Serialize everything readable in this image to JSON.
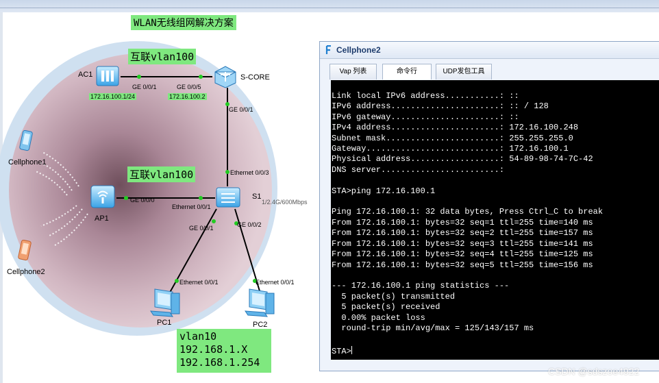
{
  "diagram": {
    "title": "WLAN无线组网解决方案",
    "interconnect_label_top": "互联vlan100",
    "interconnect_label_mid": "互联vlan100",
    "devices": {
      "ac1": "AC1",
      "score": "S-CORE",
      "s1": "S1",
      "ap1": "AP1",
      "pc1": "PC1",
      "pc2": "PC2",
      "cellphone1": "Cellphone1",
      "cellphone2": "Cellphone2"
    },
    "ip_labels": {
      "ac1_ip": "172.16.100.1/24",
      "score_ip": "172.16.100.2"
    },
    "ports": {
      "ac1_ge001": "GE 0/0/1",
      "score_ge005": "GE 0/0/5",
      "score_ge001": "GE 0/0/1",
      "s1_eth003": "Ethernet 0/0/3",
      "ap1_ge000": "GE 0/0/0",
      "s1_eth001": "Ethernet 0/0/1",
      "s1_ge001": "GE 0/0/1",
      "s1_ge002": "GE 0/0/2",
      "pc1_eth001": "Ethernet 0/0/1",
      "pc2_eth001": "Ethernet 0/0/1"
    },
    "speed": "1/2.4G/600Mbps",
    "vlan_box": [
      "vlan10",
      "192.168.1.X",
      "192.168.1.254"
    ]
  },
  "window": {
    "title": "Cellphone2",
    "tabs": [
      "Vap 列表",
      "命令行",
      "UDP发包工具"
    ],
    "console_lines": [
      "Link local IPv6 address...........: ::",
      "IPv6 address......................: :: / 128",
      "IPv6 gateway......................: ::",
      "IPv4 address......................: 172.16.100.248",
      "Subnet mask.......................: 255.255.255.0",
      "Gateway...........................: 172.16.100.1",
      "Physical address..................: 54-89-98-74-7C-42",
      "DNS server........................:",
      "",
      "STA>ping 172.16.100.1",
      "",
      "Ping 172.16.100.1: 32 data bytes, Press Ctrl_C to break",
      "From 172.16.100.1: bytes=32 seq=1 ttl=255 time=140 ms",
      "From 172.16.100.1: bytes=32 seq=2 ttl=255 time=157 ms",
      "From 172.16.100.1: bytes=32 seq=3 ttl=255 time=141 ms",
      "From 172.16.100.1: bytes=32 seq=4 ttl=255 time=125 ms",
      "From 172.16.100.1: bytes=32 seq=5 ttl=255 time=156 ms",
      "",
      "--- 172.16.100.1 ping statistics ---",
      "  5 packet(s) transmitted",
      "  5 packet(s) received",
      "  0.00% packet loss",
      "  round-trip min/avg/max = 125/143/157 ms"
    ],
    "prompt": "STA>"
  },
  "watermark": "CSDN @sdszoe4922",
  "colors": {
    "label_green": "#7fe87f",
    "console_bg": "#000000",
    "coverage": "#c7a9b5"
  }
}
